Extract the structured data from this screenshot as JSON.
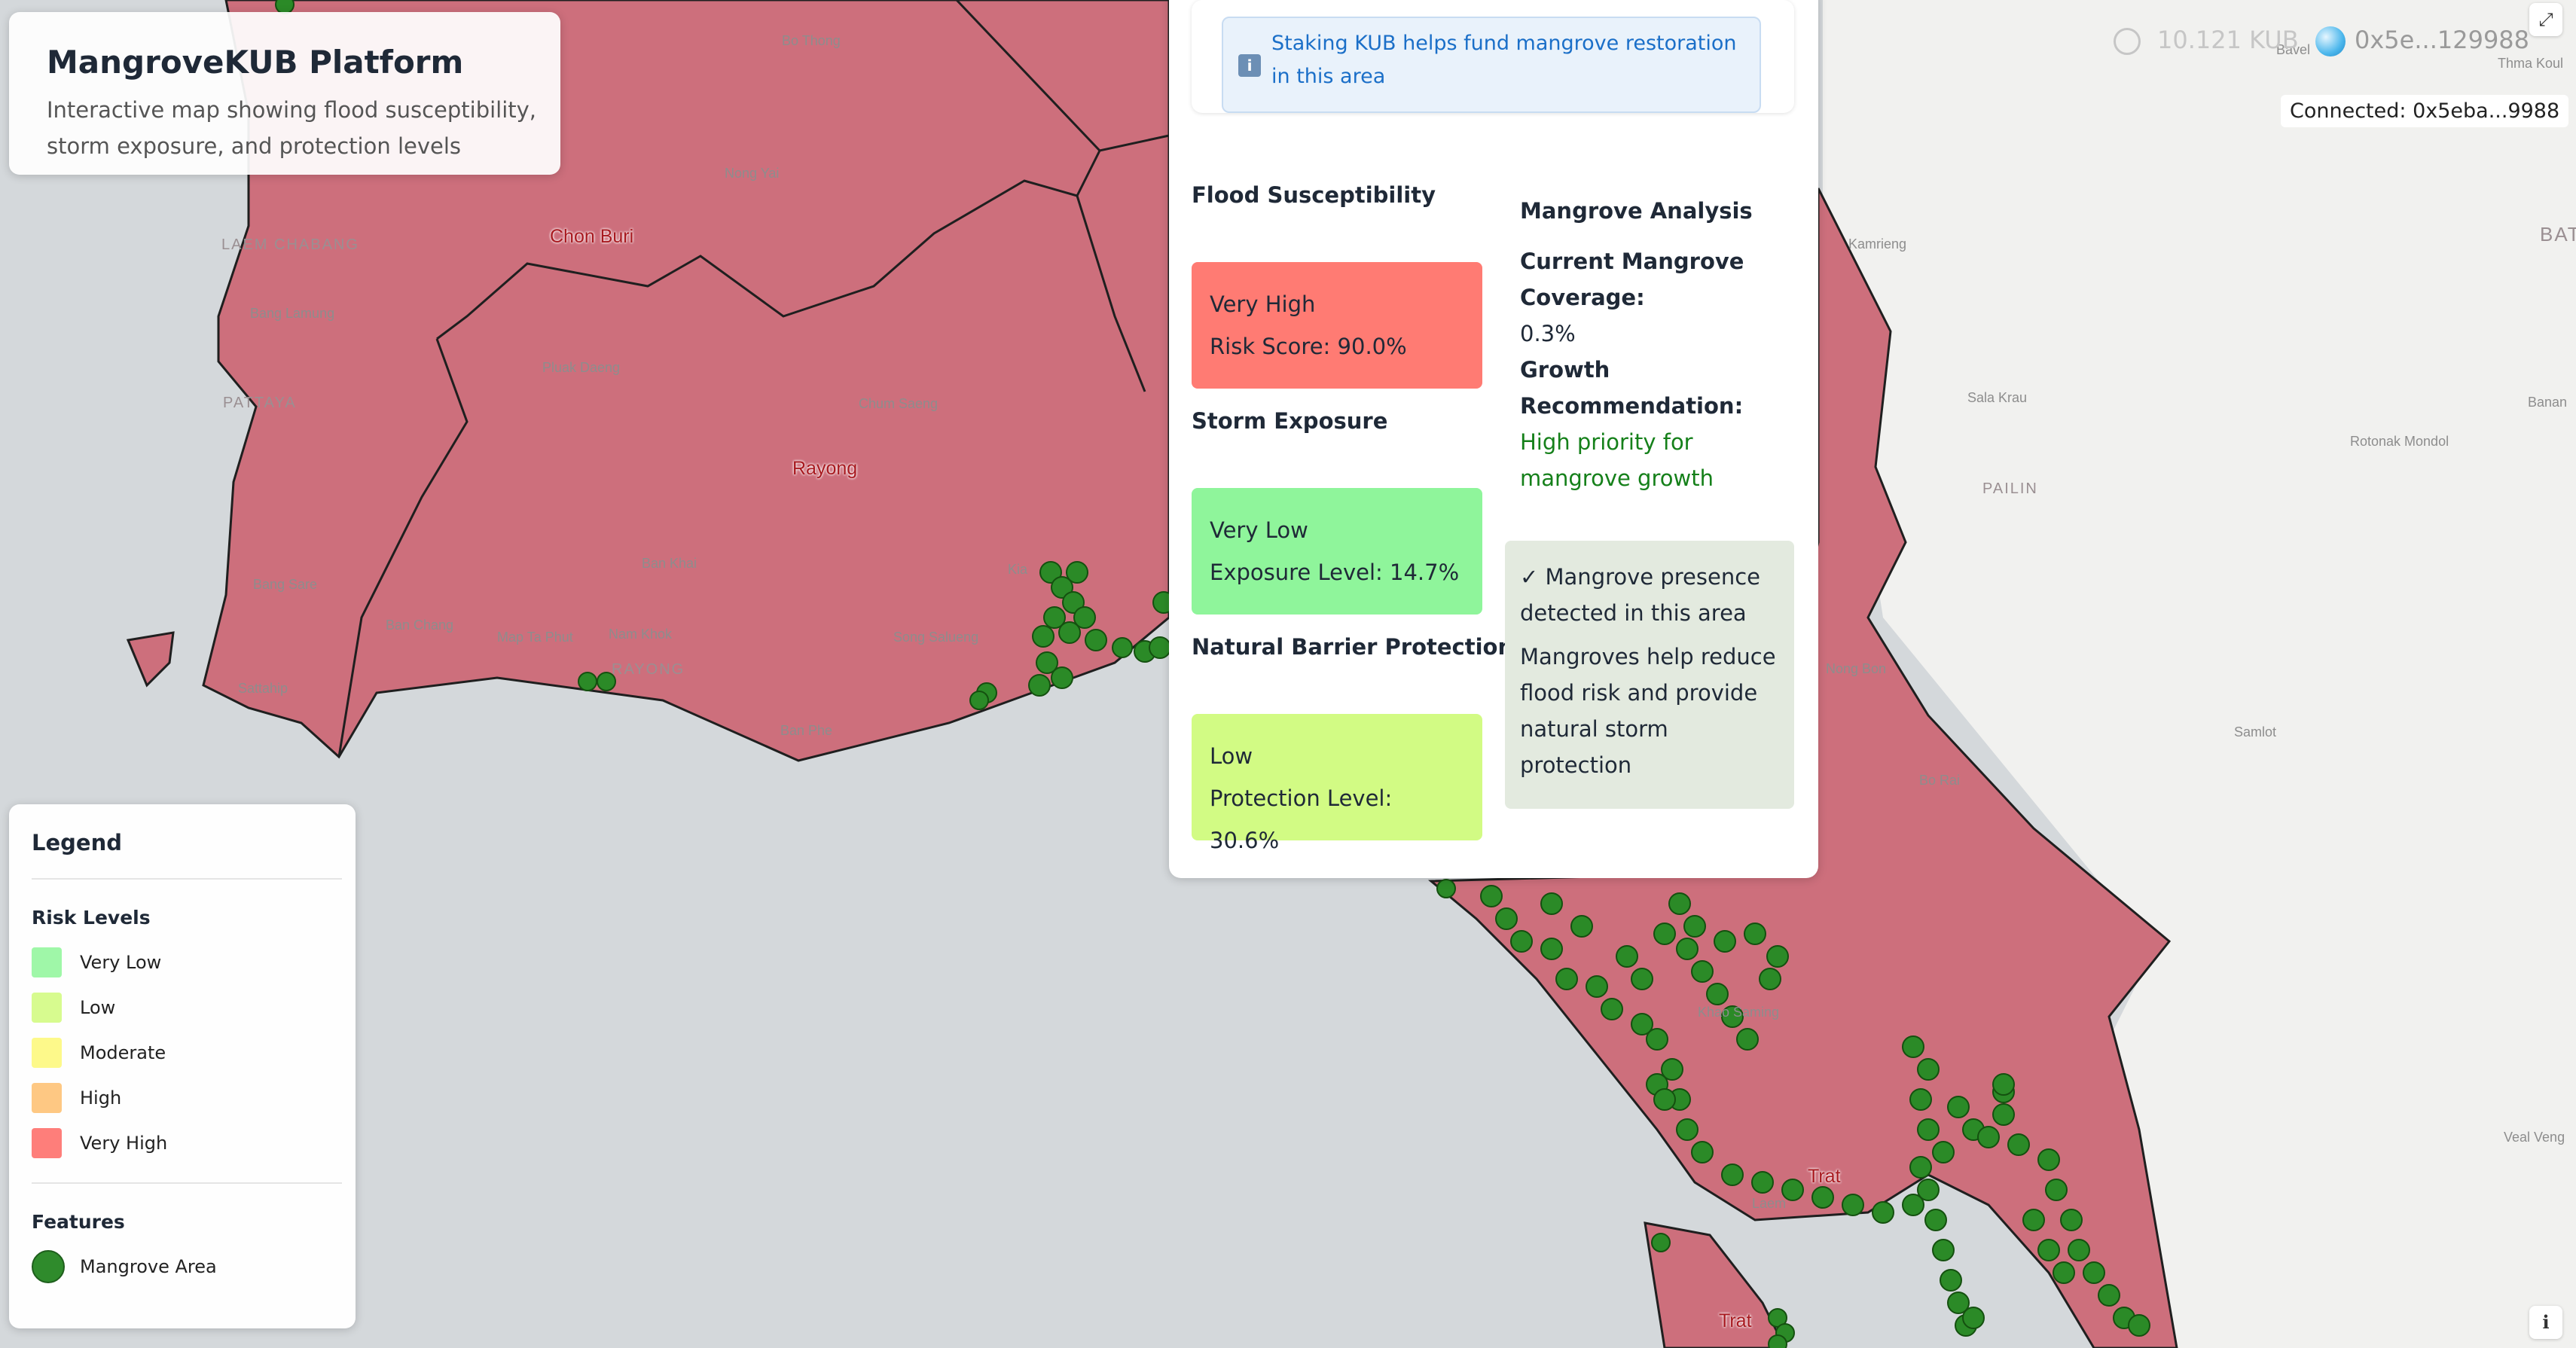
{
  "app": {
    "title": "MangroveKUB Platform",
    "subtitle": "Interactive map showing flood susceptibility, storm exposure, and protection levels"
  },
  "map_labels": {
    "cities": [
      "Chon Buri",
      "Rayong",
      "Trat",
      "Trat"
    ],
    "places": [
      "Bo Thong",
      "Nong Yai",
      "Bang Lamung",
      "Pluak Daeng",
      "Chum Saeng",
      "Ban Khai",
      "Ban Chang",
      "Map Ta Phut",
      "Nam Khok",
      "Song Salueng",
      "Ban Phe",
      "Kamrieng",
      "Sala Krau",
      "Rotonak Mondol",
      "Samlot",
      "Nong Bon",
      "Bo Rai",
      "Khao Saming",
      "Veal Veng",
      "Bavel",
      "Thma Koul",
      "Banan",
      "Kia",
      "Sattahip",
      "Laem",
      "Bang Sare"
    ],
    "caps": [
      "LAEM CHABANG",
      "PATTAYA",
      "RAYONG",
      "PAILIN",
      "BAT"
    ]
  },
  "header": {
    "stake_amount": "10.121 KUB",
    "wallet_short": "0x5e...129988",
    "connected": "Connected: 0x5eba...9988",
    "expand_icon": "expand-icon",
    "info_icon": "info-icon"
  },
  "popup": {
    "notice_icon": "info-icon",
    "notice": "Staking KUB helps fund mangrove restoration in this area",
    "flood": {
      "title": "Flood Susceptibility",
      "level": "Very High",
      "detail": "Risk Score: 90.0%",
      "color": "#ff7b73"
    },
    "storm": {
      "title": "Storm Exposure",
      "level": "Very Low",
      "detail": "Exposure Level: 14.7%",
      "color": "#8ff59b"
    },
    "barrier": {
      "title": "Natural Barrier Protection",
      "level": "Low",
      "detail": "Protection Level: 30.6%",
      "color": "#d2fb84"
    },
    "analysis": {
      "title": "Mangrove Analysis",
      "coverage_label": "Current Mangrove Coverage:",
      "coverage_value": "0.3%",
      "recommendation_label": "Growth Recommendation:",
      "recommendation_value": "High priority for mangrove growth"
    },
    "presence": {
      "detected": "✓ Mangrove presence detected in this area",
      "note": "Mangroves help reduce flood risk and provide natural storm protection"
    }
  },
  "legend": {
    "title": "Legend",
    "risk_title": "Risk Levels",
    "levels": [
      {
        "label": "Very Low",
        "color": "#9ff7a8"
      },
      {
        "label": "Low",
        "color": "#d7fb8f"
      },
      {
        "label": "Moderate",
        "color": "#fdf98a"
      },
      {
        "label": "High",
        "color": "#fec883"
      },
      {
        "label": "Very High",
        "color": "#fe7e7a"
      }
    ],
    "features_title": "Features",
    "features": [
      {
        "label": "Mangrove Area",
        "color": "#2f8b2c"
      }
    ]
  }
}
